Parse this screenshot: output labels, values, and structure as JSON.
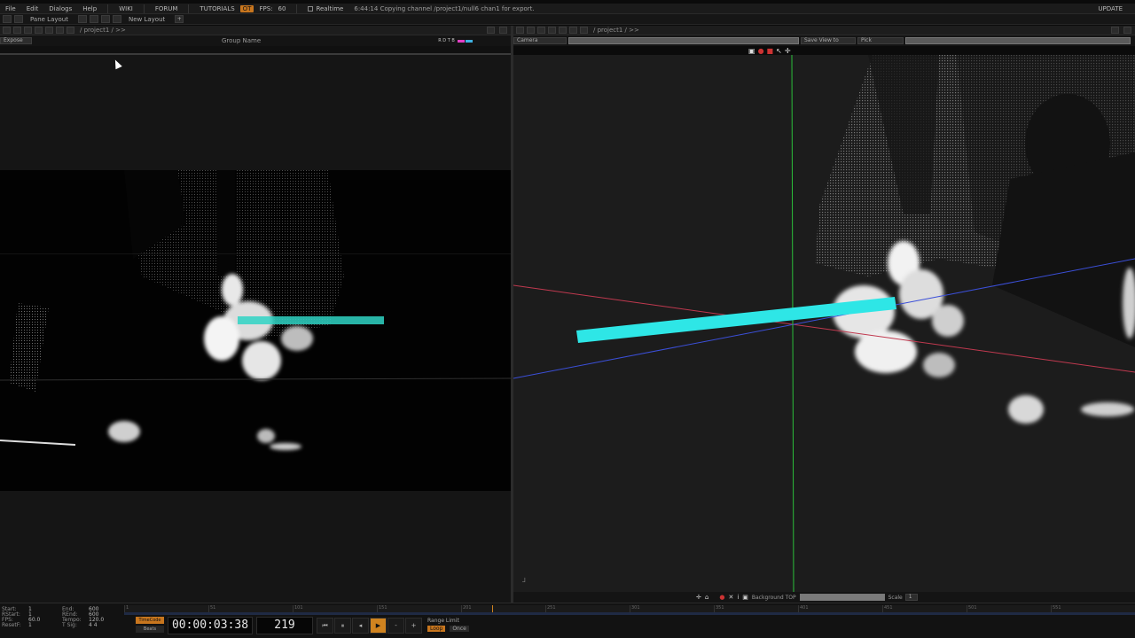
{
  "menu": {
    "items": [
      "File",
      "Edit",
      "Dialogs",
      "Help"
    ],
    "links": [
      "WIKI",
      "FORUM",
      "TUTORIALS"
    ],
    "badge": "OT",
    "fps_label": "FPS:",
    "fps_value": "60",
    "realtime": "Realtime",
    "status": "6:44:14 Copying channel /project1/null6 chan1 for export.",
    "update": "UPDATE"
  },
  "toolbar": {
    "pane_layout": "Pane Layout",
    "new_layout": "New Layout"
  },
  "left_pane": {
    "path": "/ project1 / >>",
    "expose_label": "Expose",
    "group_name": "Group Name",
    "flags": "R D T B"
  },
  "right_pane": {
    "path": "/ project1 / >>",
    "camera_select": "Camera",
    "save_view": "Save View to",
    "pick": "Pick"
  },
  "viewer_bottom": {
    "background_label": "Background TOP",
    "scale_label": "Scale",
    "scale_value": "1"
  },
  "timeline": {
    "stats": [
      {
        "k": "Start:",
        "v": "1",
        "k2": "End:",
        "v2": "600"
      },
      {
        "k": "RStart:",
        "v": "1",
        "k2": "REnd:",
        "v2": "600"
      },
      {
        "k": "FPS:",
        "v": "60.0",
        "k2": "Tempo:",
        "v2": "120.0"
      },
      {
        "k": "ResetF:",
        "v": "1",
        "k2": "T Sig:",
        "v2": "4    4"
      }
    ],
    "timecode_btn": "TimeCode",
    "beats_btn": "Beats",
    "timecode": "00:00:03:38",
    "frame": "219",
    "range_limit": "Range Limit",
    "loop": "Loop",
    "once": "Once",
    "ruler_labels": [
      "1",
      "51",
      "101",
      "151",
      "201",
      "251",
      "301",
      "351",
      "401",
      "451",
      "501",
      "551"
    ]
  },
  "colors": {
    "accent": "#d0831f",
    "beam": "#2ee6e6",
    "axis_red": "#c0394f",
    "axis_blue": "#3b4fd8",
    "axis_green": "#2bbf3a"
  }
}
